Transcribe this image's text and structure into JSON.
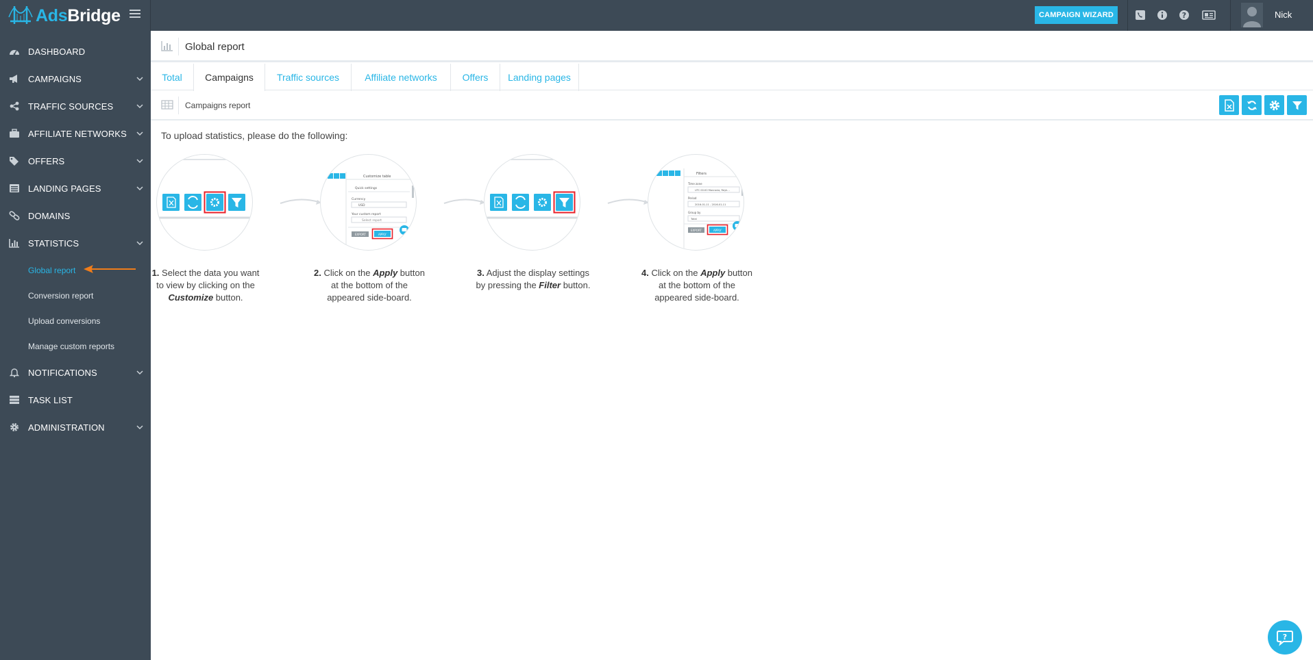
{
  "app": {
    "logo_part1": "Ads",
    "logo_part2": "Bridge",
    "user_name": "Nick",
    "wizard_label": "CAMPAIGN WIZARD"
  },
  "sidebar": {
    "items": [
      {
        "label": "DASHBOARD",
        "icon": "dashboard-icon",
        "expandable": false
      },
      {
        "label": "CAMPAIGNS",
        "icon": "megaphone-icon",
        "expandable": true
      },
      {
        "label": "TRAFFIC SOURCES",
        "icon": "share-icon",
        "expandable": true
      },
      {
        "label": "AFFILIATE NETWORKS",
        "icon": "briefcase-icon",
        "expandable": true
      },
      {
        "label": "OFFERS",
        "icon": "tags-icon",
        "expandable": true
      },
      {
        "label": "LANDING PAGES",
        "icon": "list-alt-icon",
        "expandable": true
      },
      {
        "label": "DOMAINS",
        "icon": "link-icon",
        "expandable": false
      },
      {
        "label": "STATISTICS",
        "icon": "bar-chart-icon",
        "expandable": true
      },
      {
        "label": "NOTIFICATIONS",
        "icon": "bell-icon",
        "expandable": true
      },
      {
        "label": "TASK LIST",
        "icon": "server-icon",
        "expandable": false
      },
      {
        "label": "ADMINISTRATION",
        "icon": "gear-icon",
        "expandable": true
      }
    ],
    "statistics_sub": [
      {
        "label": "Global report",
        "active": true
      },
      {
        "label": "Conversion report",
        "active": false
      },
      {
        "label": "Upload conversions",
        "active": false
      },
      {
        "label": "Manage custom reports",
        "active": false
      }
    ]
  },
  "page": {
    "title": "Global report",
    "tabs": [
      {
        "label": "Total",
        "active": false
      },
      {
        "label": "Campaigns",
        "active": true
      },
      {
        "label": "Traffic sources",
        "active": false
      },
      {
        "label": "Affiliate networks",
        "active": false
      },
      {
        "label": "Offers",
        "active": false
      },
      {
        "label": "Landing pages",
        "active": false
      }
    ],
    "report_title": "Campaigns report",
    "instructions": "To upload statistics, please do the following:",
    "steps": [
      {
        "num": "1.",
        "pre": "Select the data you want to view by clicking on the ",
        "em": "Customize",
        "post": " button."
      },
      {
        "num": "2.",
        "pre": "Click on the ",
        "em": "Apply",
        "post": " button at the bottom of the appeared side-board."
      },
      {
        "num": "3.",
        "pre": "Adjust the display settings by pressing the ",
        "em": "Filter",
        "post": " button."
      },
      {
        "num": "4.",
        "pre": "Click on the ",
        "em": "Apply",
        "post": " button at the bottom of the appeared side-board."
      }
    ],
    "mini_panel_2": {
      "title": "Customize table",
      "row1": "Quick settings",
      "label1": "Currency",
      "value1": "USD",
      "label2": "Your custom report",
      "value2": "Select report",
      "export": "EXPORT",
      "apply": "APPLY"
    },
    "mini_panel_4": {
      "title": "Filters",
      "label1": "Time zone",
      "value1": "UTC 00:00 Monrovia, Reyk...",
      "label2": "Period",
      "value2": "2016-01-11 - 2016-01-11",
      "label3": "Group by",
      "value3": "Total",
      "export": "EXPORT",
      "apply": "APPLY"
    }
  },
  "colors": {
    "accent": "#29b6e6",
    "sidebar_bg": "#3d4a56",
    "highlight_red": "#e8202a",
    "pointer_orange": "#f07d1a"
  }
}
